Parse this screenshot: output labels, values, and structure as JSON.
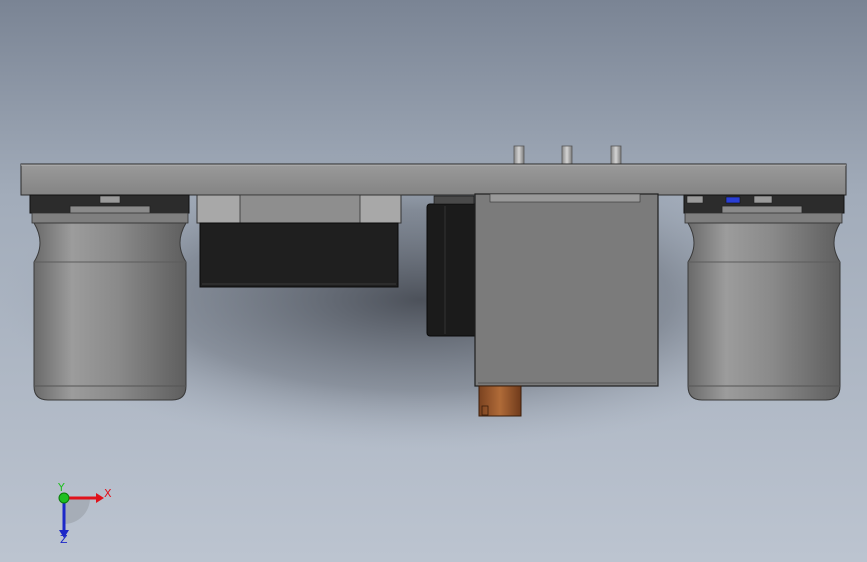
{
  "viewport": {
    "background_top": "#7d8797",
    "background_mid": "#aab4c2",
    "background_bottom": "#bac3cf"
  },
  "triad": {
    "x_label": "X",
    "y_label": "Y",
    "z_label": "Z",
    "x_color": "#e0121b",
    "y_color": "#1fbf20",
    "z_color": "#1c28c8"
  },
  "model": {
    "plate_color": "#8a8a8a",
    "body_color": "#7b7b7b",
    "dark_color": "#1e1e1e",
    "connector_color": "#9b5a2e",
    "accent_color": "#2a3fd6"
  }
}
